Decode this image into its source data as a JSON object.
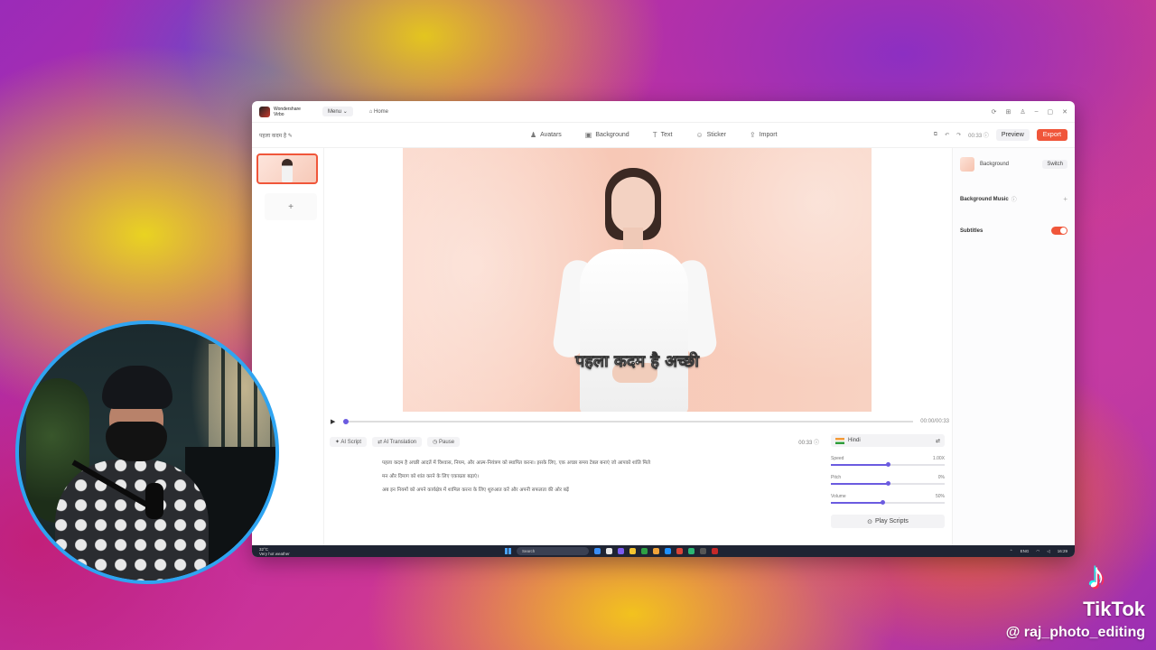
{
  "app": {
    "brand_line1": "Wondershare",
    "brand_line2": "Virbo",
    "menu_label": "Menu",
    "home_label": "Home"
  },
  "toolbar": {
    "project_name": "पहला कदम है",
    "tools": [
      "Avatars",
      "Background",
      "Text",
      "Sticker",
      "Import"
    ],
    "duration": "00:33",
    "preview_label": "Preview",
    "export_label": "Export"
  },
  "canvas": {
    "subtitle": "पहला कदम है अच्छी"
  },
  "timeline": {
    "time": "00:00/00:33"
  },
  "script": {
    "chips": [
      "AI Script",
      "AI Translation",
      "Pause"
    ],
    "duration": "00:33",
    "lines": [
      "पहला कदम है अच्छी आदतें में विश्वास, नियम, और आत्म-नियंत्रण को स्थापित करना। इसके लिए, एक अच्छा समय टेबल बनाएं जो आपको शांति मिले",
      "मन और दिमाग को शांत करने के लिए एकाग्रता बढ़ाएं।",
      "अब इन नियमों को अपने कार्यक्षेत्र में शामिल करना के लिए शुरुआत करें और अपनी सफलता की ओर बढ़ें"
    ]
  },
  "voice": {
    "language": "Hindi",
    "speed_label": "Speed",
    "speed_value": "1.00X",
    "speed_level": 0.5,
    "pitch_label": "Pitch",
    "pitch_value": "0%",
    "pitch_level": 0.5,
    "volume_label": "Volume",
    "volume_value": "50%",
    "volume_level": 0.45,
    "play_label": "Play Scripts"
  },
  "right_panel": {
    "background_label": "Background",
    "switch_label": "Switch",
    "music_label": "Background Music",
    "subtitles_label": "Subtitles"
  },
  "taskbar": {
    "weather_temp": "32°C",
    "weather_desc": "Very hot weather",
    "search_label": "Search",
    "lang": "ENG",
    "time": "16:29"
  },
  "watermark": {
    "brand": "TikTok",
    "user": "@ raj_photo_editing"
  },
  "colors": {
    "accent": "#f0563a",
    "slider": "#6b5be0",
    "webcam_ring": "#2fa4f1"
  }
}
